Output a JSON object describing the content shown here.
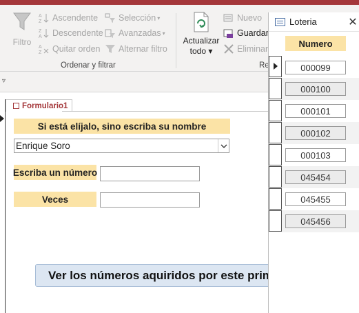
{
  "ribbon": {
    "filter_label": "Filtro",
    "ascending": "Ascendente",
    "descending": "Descendente",
    "remove_order": "Quitar orden",
    "selection": "Selección",
    "advanced": "Avanzadas",
    "toggle_filter": "Alternar filtro",
    "group_sort_filter": "Ordenar y filtrar",
    "refresh_line1": "Actualizar",
    "refresh_line2": "todo",
    "new": "Nuevo",
    "save": "Guardar",
    "delete": "Eliminar",
    "group_records_partial": "Re"
  },
  "form": {
    "tab_label": "Formulario1",
    "choose_label": "Si está elíjalo, sino escriba su nombre",
    "name_value": "Enrique Soro",
    "number_label": "Escriba un número",
    "times_label": "Veces",
    "view_button": "Ver los números aquiridos por este prim"
  },
  "loteria": {
    "title": "Loteria",
    "column_header": "Numero",
    "rows": [
      "000099",
      "000100",
      "000101",
      "000102",
      "000103",
      "045454",
      "045455",
      "045456"
    ]
  },
  "colors": {
    "accent": "#a4373a",
    "label_bg": "#fbe3a6",
    "button_bg": "#dce6f2"
  }
}
